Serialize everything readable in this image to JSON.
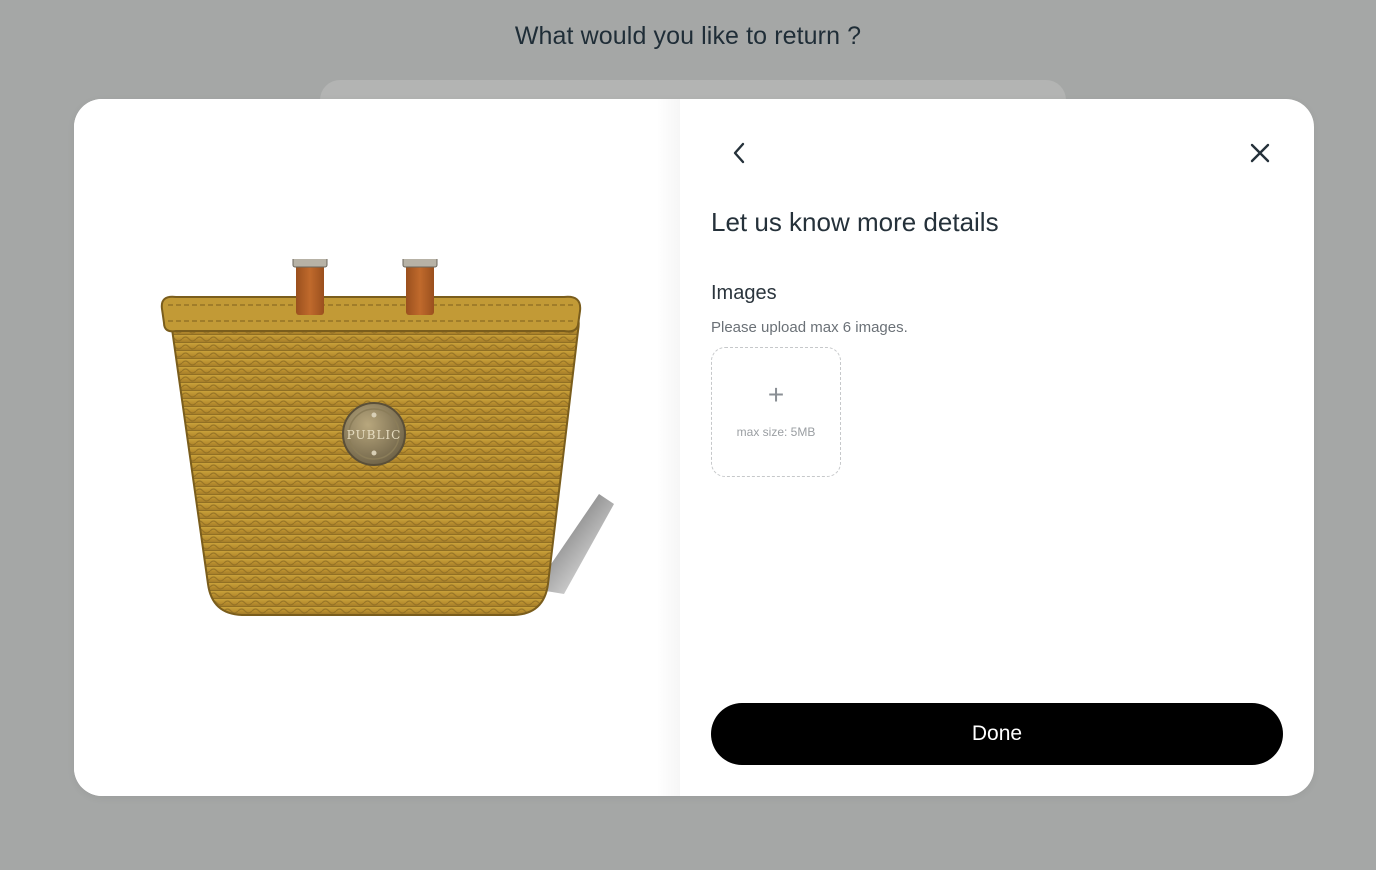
{
  "page": {
    "title": "What would you like to return ?"
  },
  "modal": {
    "details_title": "Let us know more details",
    "images_label": "Images",
    "images_hint": "Please upload max 6 images.",
    "upload": {
      "plus": "+",
      "max_size": "max size: 5MB"
    },
    "done_label": "Done",
    "badge_text": "PUBLIC"
  },
  "icons": {
    "back": "chevron-left-icon",
    "close": "close-icon",
    "add": "plus-icon"
  },
  "colors": {
    "backdrop": "#a5a7a6",
    "modal_bg": "#ffffff",
    "text_primary": "#25313a",
    "button_bg": "#000000",
    "button_text": "#ffffff"
  }
}
